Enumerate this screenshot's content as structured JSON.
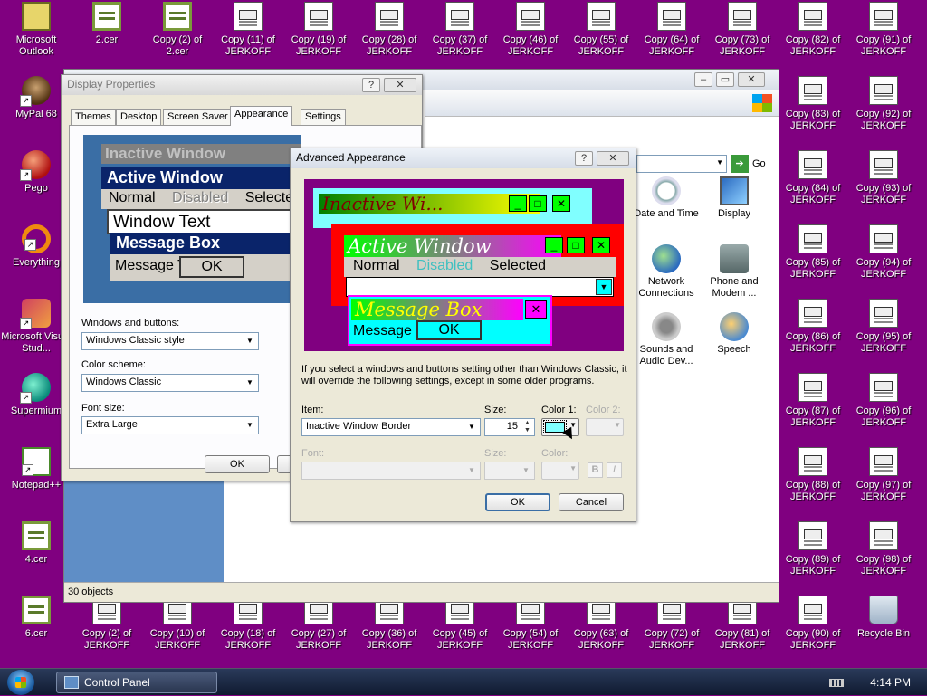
{
  "desktop": {
    "background_color": "#800080",
    "icons": [
      {
        "id": "outlook",
        "label": "Microsoft Outlook"
      },
      {
        "id": "cer2",
        "label": "2.cer"
      },
      {
        "id": "copy2of2cer",
        "label": "Copy (2) of 2.cer"
      },
      {
        "id": "c11",
        "label": "Copy (11) of JERKOFF"
      },
      {
        "id": "c19",
        "label": "Copy (19) of JERKOFF"
      },
      {
        "id": "c28",
        "label": "Copy (28) of JERKOFF"
      },
      {
        "id": "c37",
        "label": "Copy (37) of JERKOFF"
      },
      {
        "id": "c46",
        "label": "Copy (46) of JERKOFF"
      },
      {
        "id": "c55",
        "label": "Copy (55) of JERKOFF"
      },
      {
        "id": "c64",
        "label": "Copy (64) of JERKOFF"
      },
      {
        "id": "c73",
        "label": "Copy (73) of JERKOFF"
      },
      {
        "id": "c82",
        "label": "Copy (82) of JERKOFF"
      },
      {
        "id": "c91",
        "label": "Copy (91) of JERKOFF"
      },
      {
        "id": "mypal",
        "label": "MyPal 68"
      },
      {
        "id": "c83",
        "label": "Copy (83) of JERKOFF"
      },
      {
        "id": "c92",
        "label": "Copy (92) of JERKOFF"
      },
      {
        "id": "pego",
        "label": "Pego"
      },
      {
        "id": "c84",
        "label": "Copy (84) of JERKOFF"
      },
      {
        "id": "c93",
        "label": "Copy (93) of JERKOFF"
      },
      {
        "id": "everything",
        "label": "Everything"
      },
      {
        "id": "c85",
        "label": "Copy (85) of JERKOFF"
      },
      {
        "id": "c94",
        "label": "Copy (94) of JERKOFF"
      },
      {
        "id": "vs",
        "label": "Microsoft Visual Stud..."
      },
      {
        "id": "c86",
        "label": "Copy (86) of JERKOFF"
      },
      {
        "id": "c95",
        "label": "Copy (95) of JERKOFF"
      },
      {
        "id": "supermium",
        "label": "Supermium"
      },
      {
        "id": "c87",
        "label": "Copy (87) of JERKOFF"
      },
      {
        "id": "c96",
        "label": "Copy (96) of JERKOFF"
      },
      {
        "id": "notepadpp",
        "label": "Notepad++"
      },
      {
        "id": "c88",
        "label": "Copy (88) of JERKOFF"
      },
      {
        "id": "c97",
        "label": "Copy (97) of JERKOFF"
      },
      {
        "id": "cer4",
        "label": "4.cer"
      },
      {
        "id": "c89",
        "label": "Copy (89) of JERKOFF"
      },
      {
        "id": "c98",
        "label": "Copy (98) of JERKOFF"
      },
      {
        "id": "cer6",
        "label": "6.cer"
      },
      {
        "id": "c2",
        "label": "Copy (2) of JERKOFF"
      },
      {
        "id": "c10",
        "label": "Copy (10) of JERKOFF"
      },
      {
        "id": "c18",
        "label": "Copy (18) of JERKOFF"
      },
      {
        "id": "c27",
        "label": "Copy (27) of JERKOFF"
      },
      {
        "id": "c36",
        "label": "Copy (36) of JERKOFF"
      },
      {
        "id": "c45",
        "label": "Copy (45) of JERKOFF"
      },
      {
        "id": "c54",
        "label": "Copy (54) of JERKOFF"
      },
      {
        "id": "c63",
        "label": "Copy (63) of JERKOFF"
      },
      {
        "id": "c72",
        "label": "Copy (72) of JERKOFF"
      },
      {
        "id": "c81",
        "label": "Copy (81) of JERKOFF"
      },
      {
        "id": "c90",
        "label": "Copy (90) of JERKOFF"
      },
      {
        "id": "recycle",
        "label": "Recycle Bin"
      }
    ]
  },
  "control_panel": {
    "go_label": "Go",
    "status": "30 objects",
    "items": [
      {
        "label": "Date and Time",
        "icon": "clock-icon"
      },
      {
        "label": "Display",
        "icon": "display-icon"
      },
      {
        "label": "Network Connections",
        "icon": "network-icon"
      },
      {
        "label": "Phone and Modem ...",
        "icon": "phone-icon"
      },
      {
        "label": "Sounds and Audio Dev...",
        "icon": "speaker-icon"
      },
      {
        "label": "Speech",
        "icon": "speech-icon"
      }
    ]
  },
  "display_properties": {
    "title": "Display Properties",
    "tabs": [
      "Themes",
      "Desktop",
      "Screen Saver",
      "Appearance",
      "Settings"
    ],
    "selected_tab": "Appearance",
    "preview": {
      "inactive": "Inactive Window",
      "active": "Active Window",
      "menu_normal": "Normal",
      "menu_disabled": "Disabled",
      "menu_selected": "Selected",
      "window_text": "Window Text",
      "message_box": "Message Box",
      "message_text": "Message Text",
      "ok": "OK"
    },
    "windows_buttons_label": "Windows and buttons:",
    "windows_buttons_value": "Windows Classic style",
    "color_scheme_label": "Color scheme:",
    "color_scheme_value": "Windows Classic",
    "font_size_label": "Font size:",
    "font_size_value": "Extra Large",
    "ok": "OK"
  },
  "advanced_appearance": {
    "title": "Advanced Appearance",
    "preview": {
      "inactive": "Inactive Wi...",
      "active": "Active Window",
      "menu_normal": "Normal",
      "menu_disabled": "Disabled",
      "menu_selected": "Selected",
      "message_box": "Message Box",
      "message_text": "Message Text",
      "ok": "OK"
    },
    "info": "If you select a windows and buttons setting other than Windows Classic, it will override the following settings, except in some older programs.",
    "item_label": "Item:",
    "item_value": "Inactive Window Border",
    "size_label": "Size:",
    "size_value": "15",
    "color1_label": "Color 1:",
    "color2_label": "Color 2:",
    "font_label": "Font:",
    "font_size_label": "Size:",
    "font_color_label": "Color:",
    "bold": "B",
    "italic": "I",
    "ok": "OK",
    "cancel": "Cancel",
    "color1_swatch": "#80ffff"
  },
  "taskbar": {
    "window_button": "Control Panel",
    "clock": "4:14 PM"
  }
}
